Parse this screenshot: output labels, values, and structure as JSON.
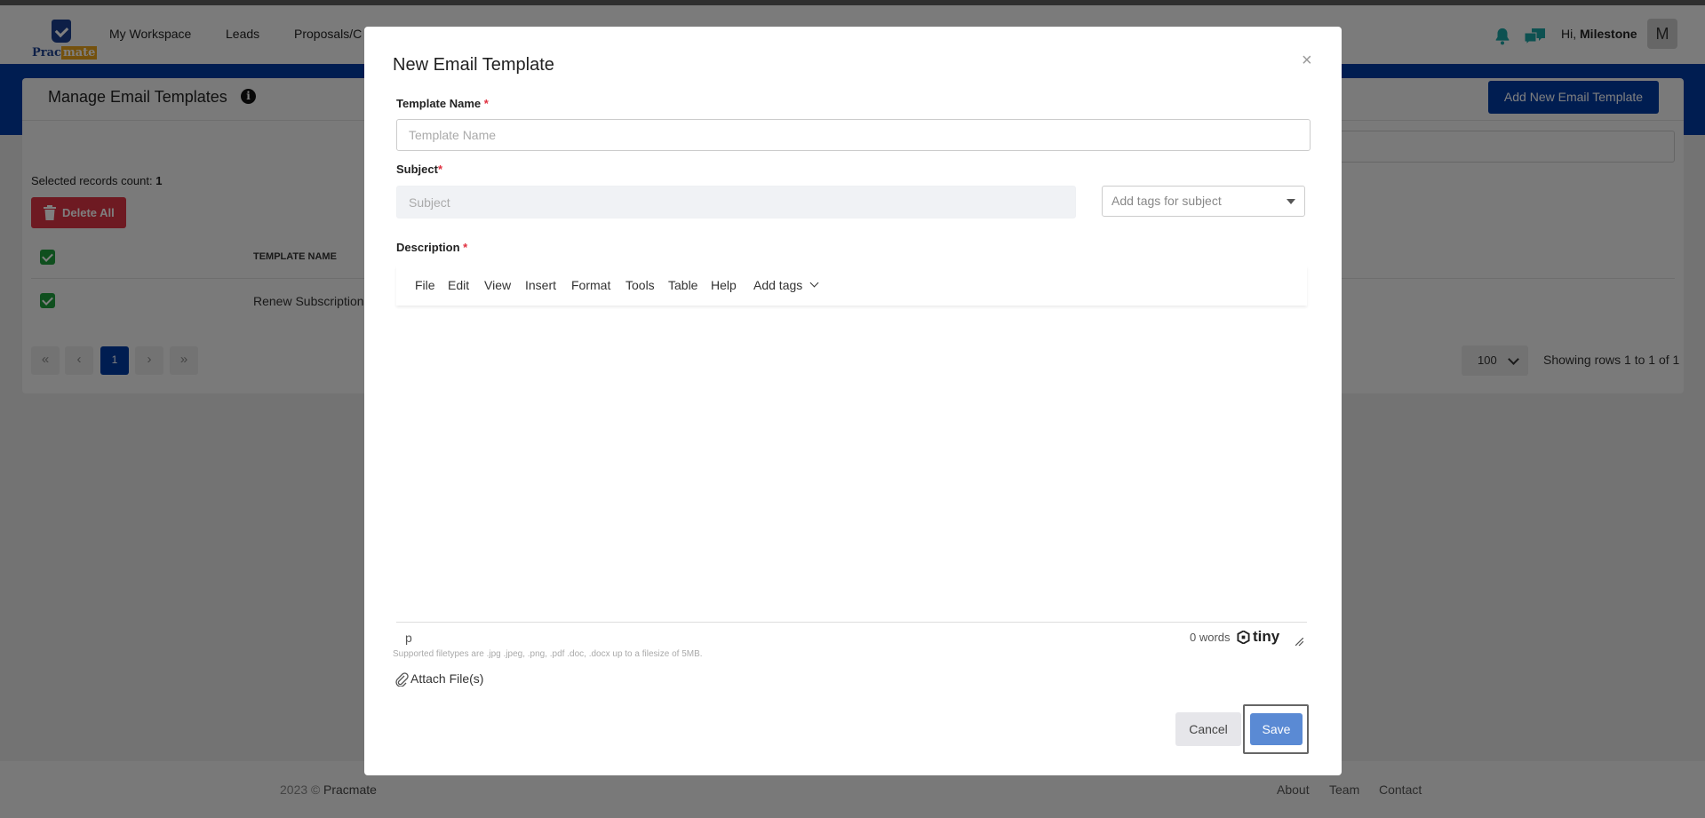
{
  "nav": {
    "brand": "Pracmate",
    "brand_part1": "Prac",
    "brand_part2": "mate",
    "items": [
      "My Workspace",
      "Leads",
      "Proposals/C"
    ],
    "greeting": "Hi,",
    "user_name": "Milestone",
    "avatar_initial": "M"
  },
  "page": {
    "title": "Manage Email Templates",
    "info_glyph": "i",
    "add_button": "Add New Email Template",
    "selected_label": "Selected records count:",
    "selected_count": "1",
    "delete_all": "Delete All",
    "col_template_name": "TEMPLATE NAME",
    "row_template_name": "Renew Subscription",
    "pagination": {
      "first": "«",
      "prev": "‹",
      "current": "1",
      "next": "›",
      "last": "»"
    },
    "rows_per_page": "100",
    "showing": "Showing rows 1 to  1 of 1"
  },
  "footer": {
    "copyright": "2023 ©",
    "brand": "Pracmate",
    "links": [
      "About",
      "Team",
      "Contact"
    ]
  },
  "modal": {
    "title": "New Email Template",
    "close": "×",
    "template_name_label": "Template Name",
    "template_name_placeholder": "Template Name",
    "template_name_value": "",
    "subject_label": "Subject",
    "subject_placeholder": "Subject",
    "subject_value": "",
    "tags_placeholder": "Add tags for subject",
    "required_mark": "*",
    "description_label": "Description",
    "editor_menu": [
      "File",
      "Edit",
      "View",
      "Insert",
      "Format",
      "Tools",
      "Table",
      "Help",
      "Add tags"
    ],
    "status_path": "p",
    "word_count": "0 words",
    "tiny_brand": "tiny",
    "supported_note": "Supported filetypes are .jpg .jpeg, .png, .pdf .doc, .docx up to a filesize of 5MB.",
    "attach_label": "Attach File(s)",
    "cancel": "Cancel",
    "save": "Save"
  },
  "colors": {
    "primary": "#003aa3",
    "danger": "#dc3545",
    "success": "#1e9e3d",
    "save": "#5a8ad4",
    "notification": "#1aa3a3"
  }
}
